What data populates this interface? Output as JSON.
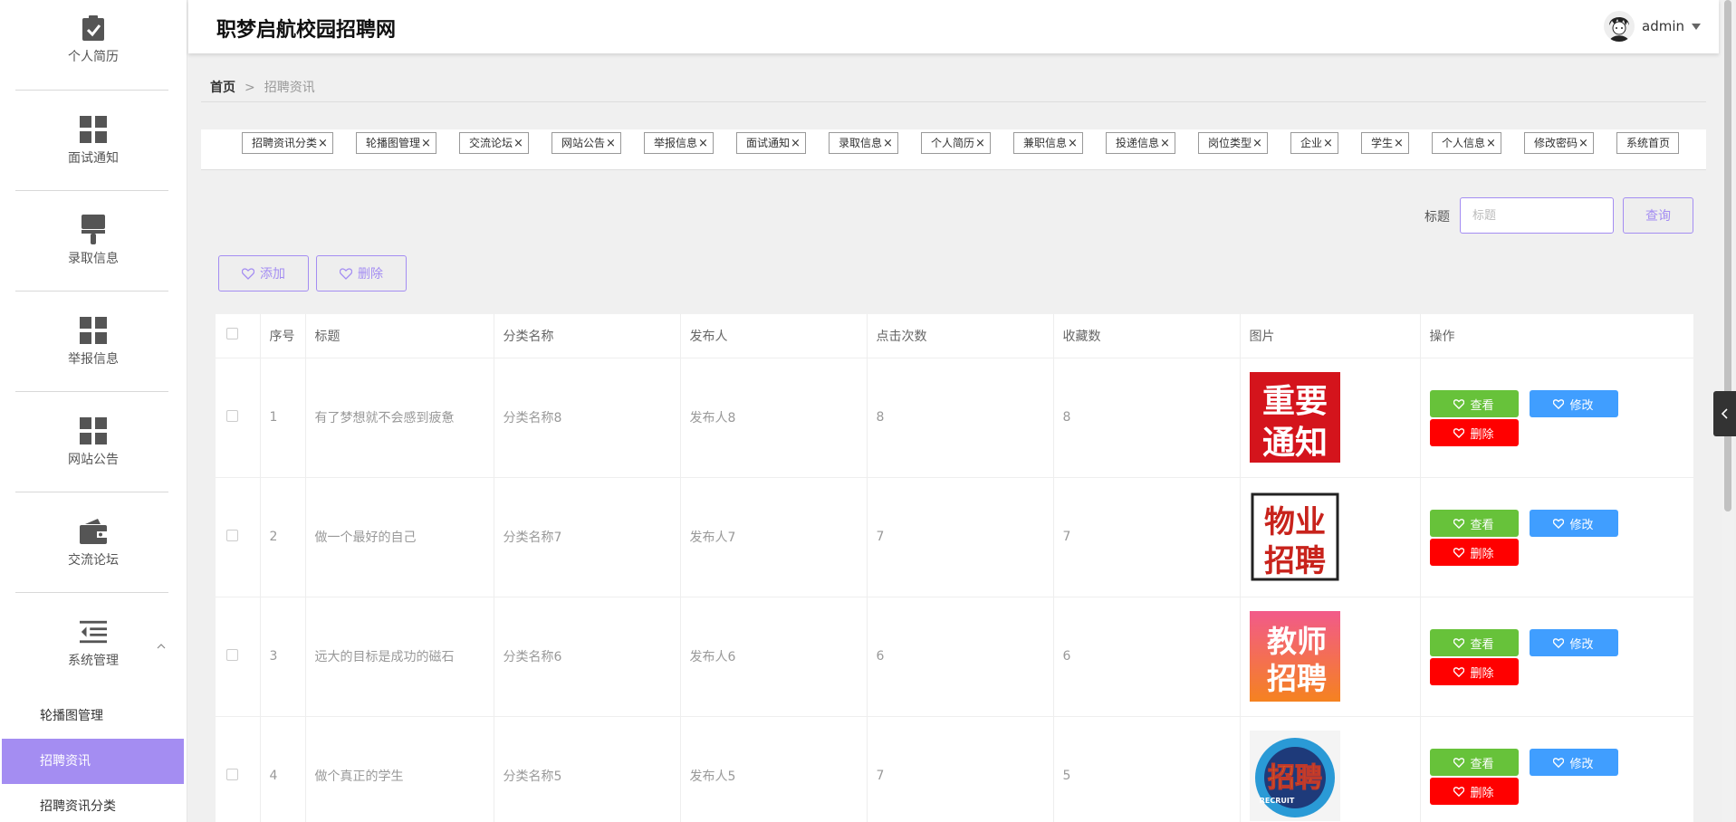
{
  "app": {
    "title": "职梦启航校园招聘网"
  },
  "user": {
    "name": "admin"
  },
  "sidebar": {
    "items": [
      {
        "label": "个人简历",
        "icon": "clipboard-check-icon"
      },
      {
        "label": "面试通知",
        "icon": "grid-icon"
      },
      {
        "label": "录取信息",
        "icon": "brush-icon"
      },
      {
        "label": "举报信息",
        "icon": "grid-icon"
      },
      {
        "label": "网站公告",
        "icon": "grid-icon"
      },
      {
        "label": "交流论坛",
        "icon": "wallet-icon"
      },
      {
        "label": "系统管理",
        "icon": "menu-indent-icon"
      }
    ],
    "sub_items": [
      {
        "label": "轮播图管理"
      },
      {
        "label": "招聘资讯"
      },
      {
        "label": "招聘资讯分类"
      }
    ]
  },
  "breadcrumb": {
    "home": "首页",
    "separator": ">",
    "current": "招聘资讯"
  },
  "tabs": [
    {
      "label": "招聘资讯分类",
      "close": "×"
    },
    {
      "label": "轮播图管理",
      "close": "×"
    },
    {
      "label": "交流论坛",
      "close": "×"
    },
    {
      "label": "网站公告",
      "close": "×"
    },
    {
      "label": "举报信息",
      "close": "×"
    },
    {
      "label": "面试通知",
      "close": "×"
    },
    {
      "label": "录取信息",
      "close": "×"
    },
    {
      "label": "个人简历",
      "close": "×"
    },
    {
      "label": "兼职信息",
      "close": "×"
    },
    {
      "label": "投递信息",
      "close": "×"
    },
    {
      "label": "岗位类型",
      "close": "×"
    },
    {
      "label": "企业",
      "close": "×"
    },
    {
      "label": "学生",
      "close": "×"
    },
    {
      "label": "个人信息",
      "close": "×"
    },
    {
      "label": "修改密码",
      "close": "×"
    },
    {
      "label": "系统首页",
      "close": ""
    }
  ],
  "search": {
    "label": "标题",
    "placeholder": "标题",
    "button": "查询"
  },
  "actions": {
    "add": "添加",
    "delete": "删除"
  },
  "table": {
    "headers": [
      "序号",
      "标题",
      "分类名称",
      "发布人",
      "点击次数",
      "收藏数",
      "图片",
      "操作"
    ],
    "rows": [
      {
        "index": "1",
        "title": "有了梦想就不会感到疲惫",
        "category": "分类名称8",
        "publisher": "发布人8",
        "clicks": "8",
        "favorites": "8",
        "image_text": [
          "重要",
          "通知"
        ]
      },
      {
        "index": "2",
        "title": "做一个最好的自己",
        "category": "分类名称7",
        "publisher": "发布人7",
        "clicks": "7",
        "favorites": "7",
        "image_text": [
          "物业",
          "招聘"
        ]
      },
      {
        "index": "3",
        "title": "远大的目标是成功的磁石",
        "category": "分类名称6",
        "publisher": "发布人6",
        "clicks": "6",
        "favorites": "6",
        "image_text": [
          "教师",
          "招聘"
        ]
      },
      {
        "index": "4",
        "title": "做个真正的学生",
        "category": "分类名称5",
        "publisher": "发布人5",
        "clicks": "7",
        "favorites": "5",
        "image_text": [
          "招聘",
          "RECRUIT"
        ]
      }
    ],
    "ops": {
      "view": "查看",
      "edit": "修改",
      "delete": "删除"
    }
  },
  "colors": {
    "accent": "#a48df2",
    "view": "#67c23a",
    "edit": "#409eff",
    "delete": "#ff0000"
  }
}
